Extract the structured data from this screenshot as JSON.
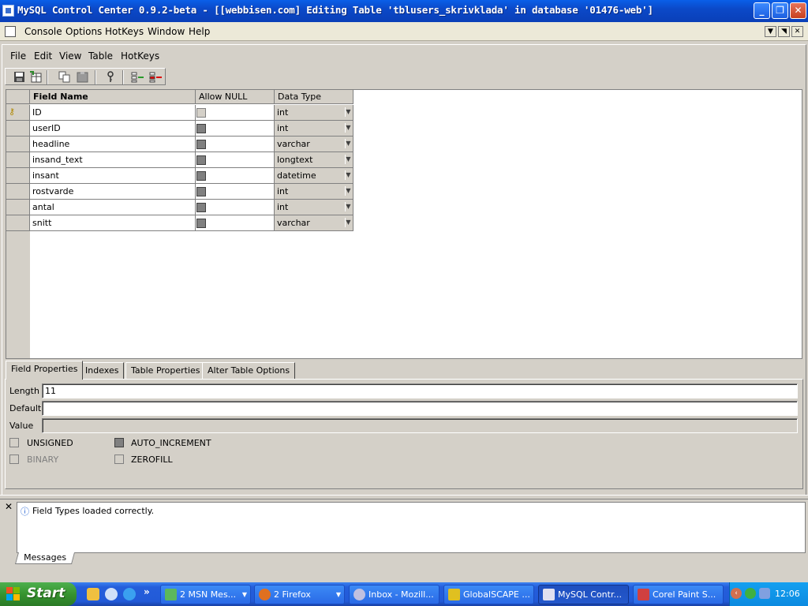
{
  "window": {
    "title": "MySQL Control Center 0.9.2-beta - [[webbisen.com] Editing Table 'tblusers_skrivklada' in database '01476-web']"
  },
  "main_menu": [
    "Console",
    "Options",
    "HotKeys",
    "Window",
    "Help"
  ],
  "editor_menu": [
    "File",
    "Edit",
    "View",
    "Table",
    "HotKeys"
  ],
  "grid": {
    "headers": {
      "field_name": "Field Name",
      "allow_null": "Allow NULL",
      "data_type": "Data Type"
    },
    "rows": [
      {
        "name": "ID",
        "type": "int",
        "primary_key": true
      },
      {
        "name": "userID",
        "type": "int"
      },
      {
        "name": "headline",
        "type": "varchar"
      },
      {
        "name": "insand_text",
        "type": "longtext"
      },
      {
        "name": "insant",
        "type": "datetime"
      },
      {
        "name": "rostvarde",
        "type": "int"
      },
      {
        "name": "antal",
        "type": "int"
      },
      {
        "name": "snitt",
        "type": "varchar"
      }
    ]
  },
  "tabs": [
    "Field Properties",
    "Indexes",
    "Table Properties",
    "Alter Table Options"
  ],
  "field_properties": {
    "length_label": "Length",
    "length_value": "11",
    "default_label": "Default",
    "default_value": "",
    "value_label": "Value",
    "value_value": "",
    "unsigned": "UNSIGNED",
    "auto_increment": "AUTO_INCREMENT",
    "binary": "BINARY",
    "zerofill": "ZEROFILL"
  },
  "messages": {
    "text": "Field Types loaded correctly.",
    "tab_label": "Messages"
  },
  "taskbar": {
    "start": "Start",
    "tasks": [
      "2 MSN Mes...",
      "2 Firefox",
      "Inbox - Mozill...",
      "GlobalSCAPE ...",
      "MySQL Contr...",
      "Corel Paint S..."
    ],
    "clock": "12:06"
  }
}
